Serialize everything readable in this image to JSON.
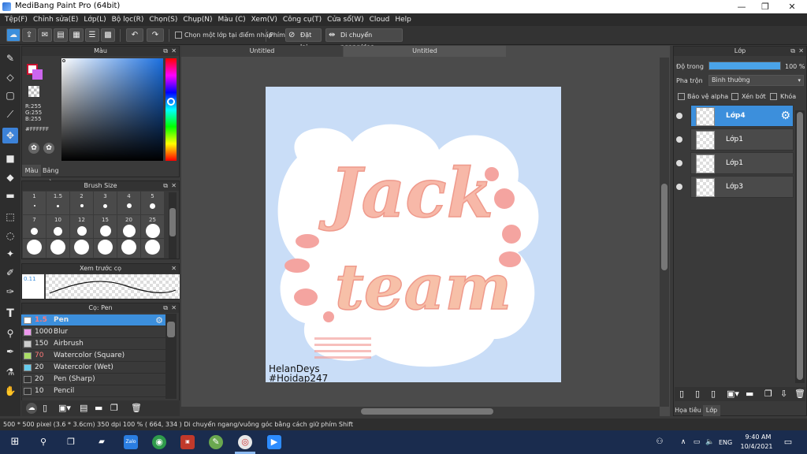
{
  "window": {
    "title": "MediBang Paint Pro (64bit)"
  },
  "menu": [
    "Tệp(F)",
    "Chỉnh sửa(E)",
    "Lớp(L)",
    "Bộ lọc(R)",
    "Chọn(S)",
    "Chụp(N)",
    "Màu (C)",
    "Xem(V)",
    "Công cụ(T)",
    "Cửa sổ(W)",
    "Cloud",
    "Help"
  ],
  "toolbar": {
    "snap_checkbox_label": "Chọn một lớp tại điểm nhấp",
    "phim_label": "Phím",
    "datlai_label": "Đặt lại",
    "dichuyen_label": "Di chuyển ngang/doc"
  },
  "color_panel": {
    "title": "Màu",
    "r": "R:255",
    "g": "G:255",
    "b": "B:255",
    "hex": "#FFFFFF",
    "tab_color": "Màu",
    "tab_palette": "Bảng màu"
  },
  "brush_size_panel": {
    "title": "Brush Size",
    "row1": [
      "1",
      "1.5",
      "2",
      "3",
      "4",
      "5"
    ],
    "row2": [
      "7",
      "10",
      "12",
      "15",
      "20",
      "25"
    ]
  },
  "preview_panel": {
    "title": "Xem trước cọ",
    "size": "0.11"
  },
  "brush_panel": {
    "title": "Cọ: Pen",
    "items": [
      {
        "size": "1.5",
        "name": "Pen",
        "color": "#3c8fdc"
      },
      {
        "size": "1000",
        "name": "Blur",
        "color": "#ee99ee"
      },
      {
        "size": "150",
        "name": "Airbrush",
        "color": "#cccccc"
      },
      {
        "size": "70",
        "name": "Watercolor (Square)",
        "color": "#aadd66"
      },
      {
        "size": "20",
        "name": "Watercolor (Wet)",
        "color": "#66ccee"
      },
      {
        "size": "20",
        "name": "Pen (Sharp)",
        "color": "#333333"
      },
      {
        "size": "10",
        "name": "Pencil",
        "color": "#333333"
      }
    ]
  },
  "documents": {
    "tab1": "Untitled",
    "tab2": "Untitled"
  },
  "artwork": {
    "line1": "Jack",
    "line2": "team",
    "sig1": "HelanDeys",
    "sig2": "#Hoidap247"
  },
  "layer_panel": {
    "title": "Lớp",
    "opacity_label": "Độ trong",
    "opacity_value": "100 %",
    "opacity_fraction": 1.0,
    "blend_label": "Pha trộn",
    "blend_value": "Bình thường",
    "protect_alpha": "Bảo vệ alpha",
    "clip": "Xén bớt",
    "lock": "Khóa",
    "layers": [
      "Lớp4",
      "Lớp1",
      "Lớp1",
      "Lớp3"
    ],
    "tab_material": "Họa tiêu",
    "tab_layer": "Lớp"
  },
  "status": {
    "text": "500 * 500 pixel   (3.6 * 3.6cm)   350 dpi   100 %   ( 664, 334 )   Di chuyển ngang/vuông góc bằng cách giữ phím Shift"
  },
  "taskbar": {
    "time": "9:40 AM",
    "date": "10/4/2021",
    "lang": "ENG"
  },
  "colors": {
    "accent": "#3c8fdc",
    "canvas_bg": "#c9ddf7",
    "letter": "#f7b8a8",
    "primary_color": "#c8102e",
    "secondary_color": "#ffffff"
  }
}
